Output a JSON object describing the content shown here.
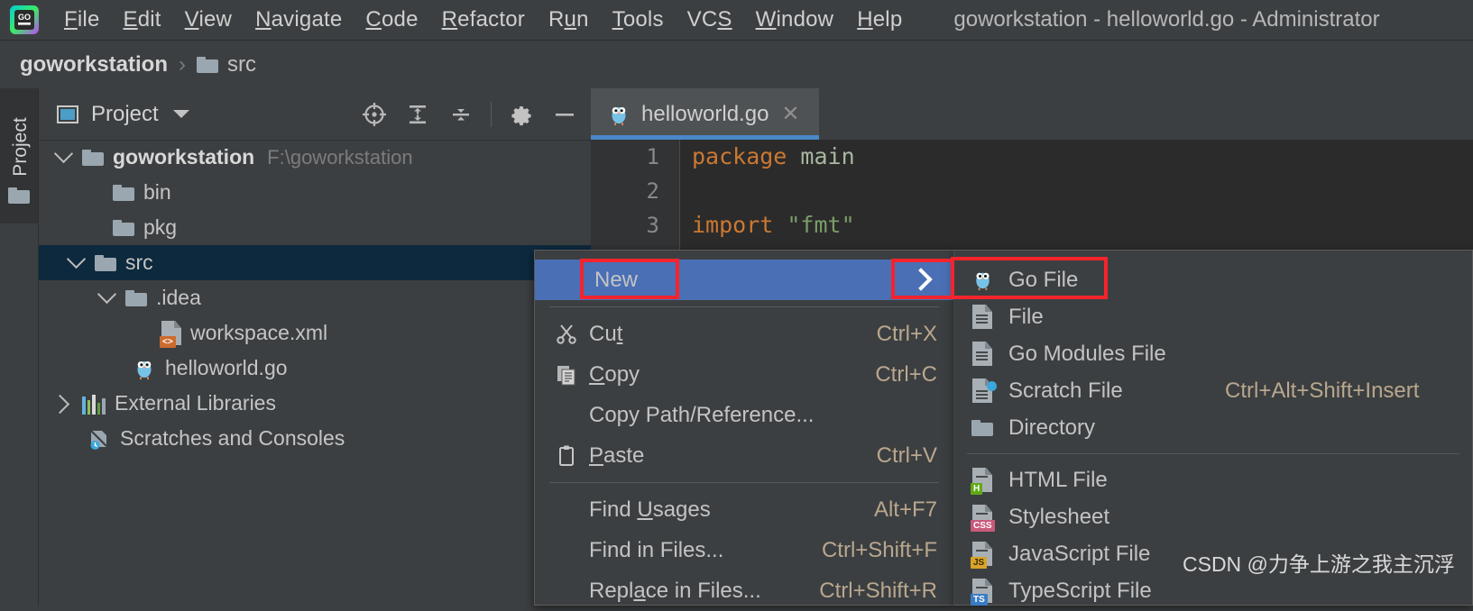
{
  "window": {
    "title": "goworkstation - helloworld.go - Administrator",
    "logo_icon": "goland-logo-icon"
  },
  "menubar": {
    "items": [
      {
        "label": "File",
        "mnemonic": "F"
      },
      {
        "label": "Edit",
        "mnemonic": "E"
      },
      {
        "label": "View",
        "mnemonic": "V"
      },
      {
        "label": "Navigate",
        "mnemonic": "N"
      },
      {
        "label": "Code",
        "mnemonic": "C"
      },
      {
        "label": "Refactor",
        "mnemonic": "R"
      },
      {
        "label": "Run",
        "mnemonic": "u"
      },
      {
        "label": "Tools",
        "mnemonic": "T"
      },
      {
        "label": "VCS",
        "mnemonic": "S"
      },
      {
        "label": "Window",
        "mnemonic": "W"
      },
      {
        "label": "Help",
        "mnemonic": "H"
      }
    ]
  },
  "breadcrumb": {
    "root": "goworkstation",
    "separator": "›",
    "leaf": "src",
    "leaf_icon": "folder-icon"
  },
  "toolstrip": {
    "label": "Project",
    "icon": "folder-icon"
  },
  "project_panel": {
    "title": "Project",
    "title_icon": "project-view-icon",
    "dropdown_icon": "chevron-down-icon",
    "tools": [
      {
        "name": "locate-icon",
        "title": "Select Opened File"
      },
      {
        "name": "expand-all-icon",
        "title": "Expand All"
      },
      {
        "name": "collapse-all-icon",
        "title": "Collapse All"
      },
      {
        "name": "gear-icon",
        "title": "Settings"
      },
      {
        "name": "minimize-icon",
        "title": "Hide"
      }
    ],
    "tree": [
      {
        "label": "goworkstation",
        "path": "F:\\goworkstation",
        "icon": "folder-icon",
        "twisty": "down",
        "indent": 0,
        "bold": true,
        "selected": false
      },
      {
        "label": "bin",
        "path": "",
        "icon": "folder-icon",
        "twisty": "none",
        "indent": 1,
        "bold": false,
        "selected": false
      },
      {
        "label": "pkg",
        "path": "",
        "icon": "folder-icon",
        "twisty": "none",
        "indent": 1,
        "bold": false,
        "selected": false
      },
      {
        "label": "src",
        "path": "",
        "icon": "folder-icon",
        "twisty": "down",
        "indent": 1,
        "bold": false,
        "selected": true
      },
      {
        "label": ".idea",
        "path": "",
        "icon": "folder-icon",
        "twisty": "down",
        "indent": 2,
        "bold": false,
        "selected": false
      },
      {
        "label": "workspace.xml",
        "path": "",
        "icon": "xml-file-icon",
        "twisty": "none",
        "indent": 3,
        "bold": false,
        "selected": false
      },
      {
        "label": "helloworld.go",
        "path": "",
        "icon": "go-file-icon",
        "twisty": "none",
        "indent": 2,
        "bold": false,
        "selected": false
      },
      {
        "label": "External Libraries",
        "path": "",
        "icon": "libraries-icon",
        "twisty": "right",
        "indent": 0,
        "bold": false,
        "selected": false
      },
      {
        "label": "Scratches and Consoles",
        "path": "",
        "icon": "scratches-icon",
        "twisty": "none",
        "indent": 0,
        "bold": false,
        "selected": false
      }
    ]
  },
  "editor": {
    "tab": {
      "label": "helloworld.go",
      "icon": "go-file-icon",
      "close_icon": "close-icon"
    },
    "lines": [
      {
        "number": "1",
        "tokens": [
          {
            "t": "package",
            "c": "kw"
          },
          {
            "t": " ",
            "c": ""
          },
          {
            "t": "main",
            "c": "id"
          }
        ]
      },
      {
        "number": "2",
        "tokens": []
      },
      {
        "number": "3",
        "tokens": [
          {
            "t": "import",
            "c": "kw"
          },
          {
            "t": " ",
            "c": ""
          },
          {
            "t": "\"fmt\"",
            "c": "str"
          }
        ]
      }
    ]
  },
  "context_menu": {
    "items": [
      {
        "label": "New",
        "shortcut": "",
        "icon": "",
        "highlighted": true,
        "submenu": true,
        "mnemonic": ""
      },
      {
        "sep": true
      },
      {
        "label": "Cut",
        "shortcut": "Ctrl+X",
        "icon": "scissors-icon",
        "mnemonic": "t"
      },
      {
        "label": "Copy",
        "shortcut": "Ctrl+C",
        "icon": "copy-icon",
        "mnemonic": "C"
      },
      {
        "label": "Copy Path/Reference...",
        "shortcut": "",
        "icon": "",
        "mnemonic": ""
      },
      {
        "label": "Paste",
        "shortcut": "Ctrl+V",
        "icon": "clipboard-icon",
        "mnemonic": "P"
      },
      {
        "sep": true
      },
      {
        "label": "Find Usages",
        "shortcut": "Alt+F7",
        "icon": "",
        "mnemonic": "U"
      },
      {
        "label": "Find in Files...",
        "shortcut": "Ctrl+Shift+F",
        "icon": "",
        "mnemonic": ""
      },
      {
        "label": "Replace in Files...",
        "shortcut": "Ctrl+Shift+R",
        "icon": "",
        "mnemonic": "a"
      }
    ]
  },
  "submenu": {
    "items": [
      {
        "label": "Go File",
        "shortcut": "",
        "icon": "go-file-icon"
      },
      {
        "label": "File",
        "shortcut": "",
        "icon": "file-icon"
      },
      {
        "label": "Go Modules File",
        "shortcut": "",
        "icon": "file-icon"
      },
      {
        "label": "Scratch File",
        "shortcut": "Ctrl+Alt+Shift+Insert",
        "icon": "scratch-file-icon"
      },
      {
        "label": "Directory",
        "shortcut": "",
        "icon": "folder-icon"
      },
      {
        "sep": true
      },
      {
        "label": "HTML File",
        "shortcut": "",
        "icon": "html-file-icon"
      },
      {
        "label": "Stylesheet",
        "shortcut": "",
        "icon": "css-file-icon"
      },
      {
        "label": "JavaScript File",
        "shortcut": "",
        "icon": "js-file-icon"
      },
      {
        "label": "TypeScript File",
        "shortcut": "",
        "icon": "ts-file-icon"
      }
    ]
  },
  "annotations": {
    "boxes": [
      "new-menu-item",
      "submenu-arrow",
      "go-file-item"
    ],
    "color": "#f5232c"
  },
  "watermark": {
    "text": "CSDN @力争上游之我主沉浮"
  }
}
